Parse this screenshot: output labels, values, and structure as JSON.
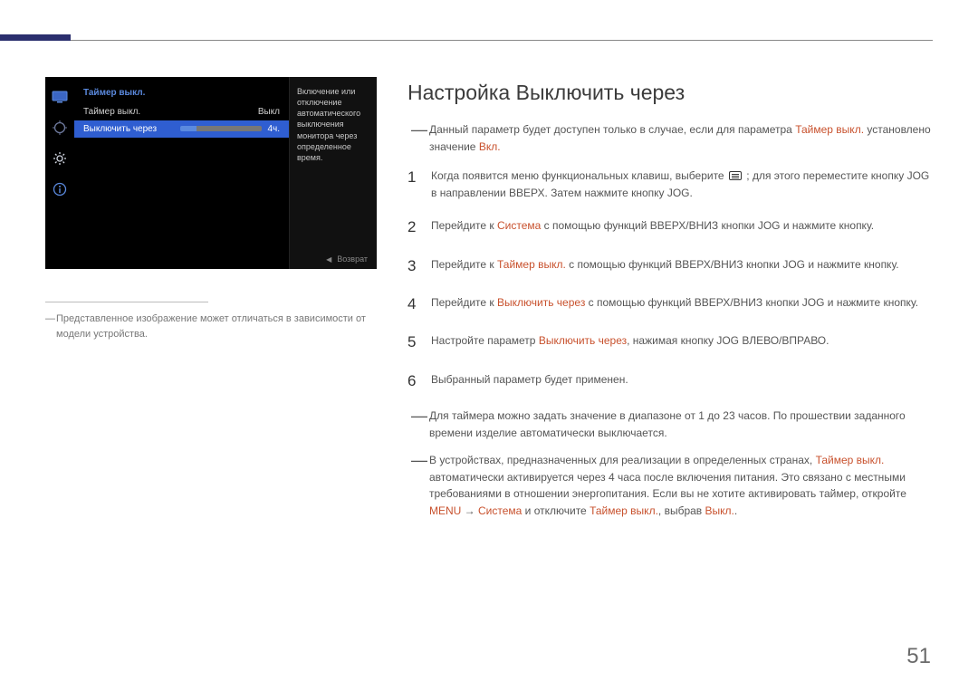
{
  "page_number": "51",
  "osd": {
    "title": "Таймер выкл.",
    "rows": [
      {
        "label": "Таймер выкл.",
        "value": "Выкл"
      },
      {
        "label": "Выключить через",
        "value": "4ч."
      }
    ],
    "desc": "Включение или отключение автоматического выключения монитора через определенное время.",
    "back_label": "Возврат"
  },
  "caption": "Представленное изображение может отличаться в зависимости от модели устройства.",
  "title": "Настройка Выключить через",
  "intro_pre": "Данный параметр будет доступен только в случае, если для параметра ",
  "intro_accent1": "Таймер выкл.",
  "intro_mid": " установлено значение ",
  "intro_accent2": "Вкл.",
  "steps": {
    "s1a": "Когда появится меню функциональных клавиш, выберите ",
    "s1b": " ; для этого переместите кнопку JOG в направлении ВВЕРХ. Затем нажмите кнопку JOG.",
    "s2a": "Перейдите к ",
    "s2hl": "Система",
    "s2b": " с помощью функций ВВЕРХ/ВНИЗ кнопки JOG и нажмите кнопку.",
    "s3a": "Перейдите к ",
    "s3hl": "Таймер выкл.",
    "s3b": " с помощью функций ВВЕРХ/ВНИЗ кнопки JOG и нажмите кнопку.",
    "s4a": "Перейдите к ",
    "s4hl": "Выключить через",
    "s4b": " с помощью функций ВВЕРХ/ВНИЗ кнопки JOG и нажмите кнопку.",
    "s5a": "Настройте параметр ",
    "s5hl": "Выключить через",
    "s5b": ", нажимая кнопку JOG ВЛЕВО/ВПРАВО.",
    "s6": "Выбранный параметр будет применен."
  },
  "footnote1": "Для таймера можно задать значение в диапазоне от 1 до 23 часов. По прошествии заданного времени изделие автоматически выключается.",
  "fn2_a": "В устройствах, предназначенных для реализации в определенных странах, ",
  "fn2_hl1": "Таймер выкл.",
  "fn2_b": " автоматически активируется через 4 часа после включения питания. Это связано с местными требованиями в отношении энергопитания. Если вы не хотите активировать таймер, откройте ",
  "fn2_hl2": "MENU",
  "fn2_arrow": " → ",
  "fn2_hl3": "Система",
  "fn2_c": " и отключите ",
  "fn2_hl4": "Таймер выкл.",
  "fn2_d": ", выбрав ",
  "fn2_hl5": "Выкл.",
  "fn2_e": "."
}
